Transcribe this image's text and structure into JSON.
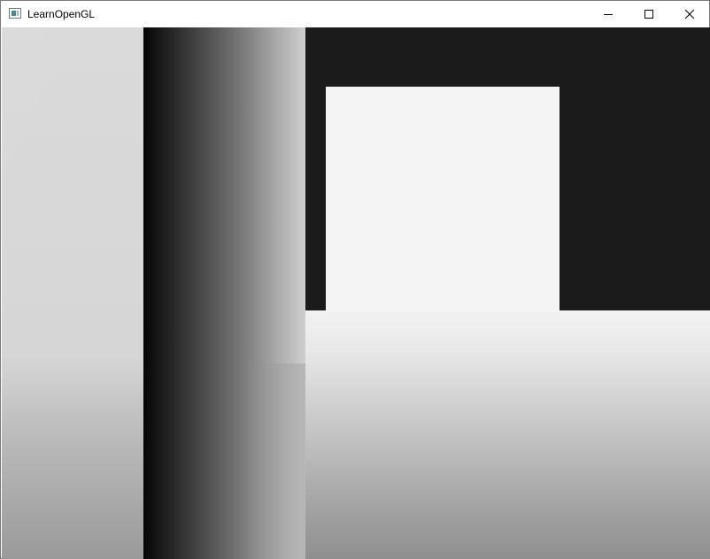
{
  "window": {
    "title": "LearnOpenGL",
    "app_icon": "opengl-window-icon",
    "controls": {
      "minimize_icon": "minimize-icon",
      "maximize_icon": "maximize-icon",
      "close_icon": "close-icon"
    }
  },
  "scene": {
    "description_kind": "depth-buffer-render",
    "colors": {
      "background": "#1b1b1b",
      "left_wall": "#dadada",
      "pillar_dark": "#050505",
      "pillar_light": "#cfcfcf",
      "cube": "#f4f4f4",
      "floor_top": "#f2f2f2",
      "floor_bottom": "#8f8f8f"
    }
  }
}
